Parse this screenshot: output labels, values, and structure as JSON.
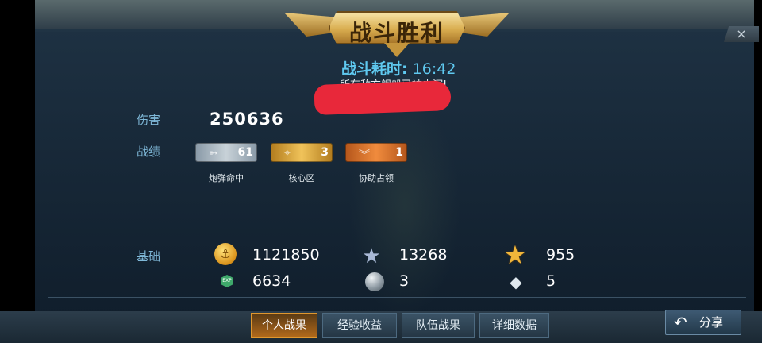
{
  "header": {
    "title": "战斗胜利",
    "close_label": "×"
  },
  "battle": {
    "time_label": "战斗耗时:",
    "time_value": "16:42",
    "note": "所有敌方舰船已被击沉!"
  },
  "damage": {
    "label": "伤害",
    "value": "250636"
  },
  "record": {
    "label": "战绩",
    "medals": [
      {
        "count": "61",
        "caption": "炮弹命中",
        "icon": "shell-hit-icon"
      },
      {
        "count": "3",
        "caption": "核心区",
        "icon": "core-zone-icon"
      },
      {
        "count": "1",
        "caption": "协助占领",
        "icon": "assist-capture-icon"
      }
    ]
  },
  "basic": {
    "label": "基础",
    "items": [
      {
        "icon": "anchor-coin-icon",
        "value": "1121850"
      },
      {
        "icon": "silver-star-icon",
        "value": "13268"
      },
      {
        "icon": "gold-star-icon",
        "value": "955"
      },
      {
        "icon": "exp-icon",
        "icon_text": "EXP",
        "value": "6634"
      },
      {
        "icon": "sphere-icon",
        "value": "3"
      },
      {
        "icon": "diamond-icon",
        "value": "5"
      }
    ]
  },
  "tabs": [
    {
      "label": "个人战果",
      "active": true
    },
    {
      "label": "经验收益",
      "active": false
    },
    {
      "label": "队伍战果",
      "active": false
    },
    {
      "label": "详细数据",
      "active": false
    }
  ],
  "share": {
    "label": "分享"
  },
  "colors": {
    "accent": "#5fc9f0",
    "gold": "#f1b63a",
    "active_tab": "#b36a1b"
  }
}
